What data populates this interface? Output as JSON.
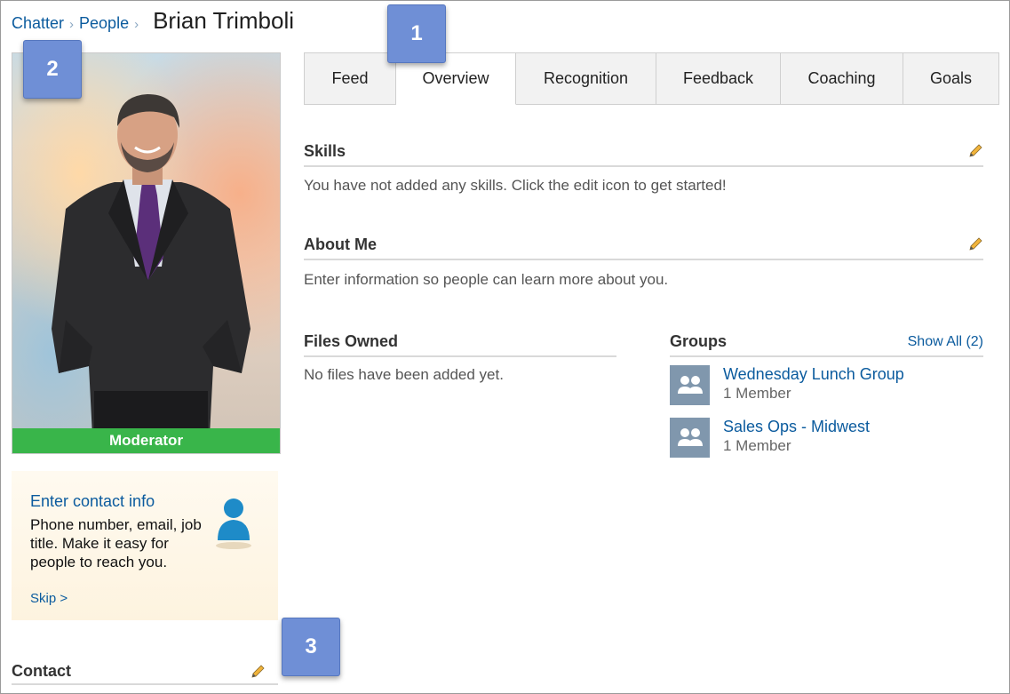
{
  "breadcrumb": {
    "items": [
      "Chatter",
      "People"
    ],
    "separator": "›",
    "title": "Brian Trimboli"
  },
  "profile": {
    "role_badge": "Moderator",
    "badge_color": "#39b54a"
  },
  "contact_prompt": {
    "title": "Enter contact info",
    "description": "Phone number, email, job title. Make it easy for people to reach you.",
    "skip_label": "Skip >"
  },
  "contact": {
    "heading": "Contact",
    "edit_icon": "pencil-icon"
  },
  "tabs": [
    {
      "label": "Feed",
      "active": false
    },
    {
      "label": "Overview",
      "active": true
    },
    {
      "label": "Recognition",
      "active": false
    },
    {
      "label": "Feedback",
      "active": false
    },
    {
      "label": "Coaching",
      "active": false
    },
    {
      "label": "Goals",
      "active": false
    }
  ],
  "skills": {
    "heading": "Skills",
    "empty_text": "You have not added any skills. Click the edit icon to get started!"
  },
  "about_me": {
    "heading": "About Me",
    "empty_text": "Enter information so people can learn more about you."
  },
  "files": {
    "heading": "Files Owned",
    "empty_text": "No files have been added yet."
  },
  "groups": {
    "heading": "Groups",
    "show_all": "Show All (2)",
    "items": [
      {
        "name": "Wednesday Lunch Group",
        "members": "1 Member",
        "icon": "group-icon"
      },
      {
        "name": "Sales Ops - Midwest",
        "members": "1 Member",
        "icon": "group-icon"
      }
    ]
  },
  "callouts": [
    "1",
    "2",
    "3"
  ],
  "colors": {
    "link": "#0b5b9e",
    "callout": "#6f8fd6",
    "group_icon_bg": "#8097ad"
  }
}
